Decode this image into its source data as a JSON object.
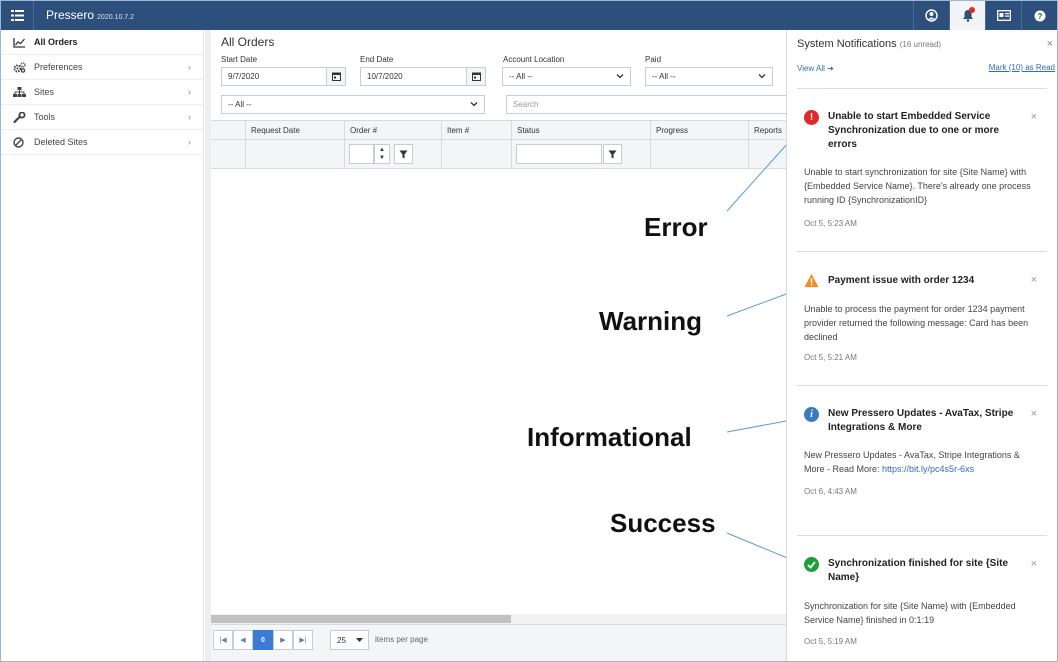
{
  "app": {
    "brand": "Pressero",
    "version": "2020.10.7.2"
  },
  "sidebar": {
    "items": [
      {
        "label": "All Orders",
        "icon": "chart-line-icon"
      },
      {
        "label": "Preferences",
        "icon": "cogs-icon"
      },
      {
        "label": "Sites",
        "icon": "sitemap-icon"
      },
      {
        "label": "Tools",
        "icon": "wrench-icon"
      },
      {
        "label": "Deleted Sites",
        "icon": "ban-icon"
      }
    ]
  },
  "main": {
    "title": "All Orders",
    "filters": {
      "start_date_label": "Start Date",
      "start_date_value": "9/7/2020",
      "end_date_label": "End Date",
      "end_date_value": "10/7/2020",
      "account_location_label": "Account Location",
      "account_location_value": "-- All --",
      "paid_label": "Paid",
      "paid_value": "-- All --",
      "second_row_select": "-- All --",
      "search_placeholder": "Search"
    },
    "columns": [
      "Request Date",
      "Order #",
      "Item #",
      "Status",
      "Progress",
      "Reports"
    ],
    "pager": {
      "current_page": "0",
      "page_size": "25",
      "page_size_label": "items per page"
    }
  },
  "notifications": {
    "title": "System Notifications",
    "unread": "(16 unread)",
    "view_all": "View All",
    "mark_read": "Mark (10) as Read",
    "items": [
      {
        "type": "error",
        "title": "Unable to start Embedded Service Synchronization due to one or more errors",
        "body": "Unable to start synchronization for site {Site Name} with {Embedded Service Name}. There's already one process running ID {SynchronizationID}",
        "time": "Oct 5, 5:23 AM"
      },
      {
        "type": "warning",
        "title": "Payment issue with order 1234",
        "body": "Unable to process the payment for order 1234 payment provider returned the following message: Card has been declined",
        "time": "Oct 5, 5:21 AM"
      },
      {
        "type": "info",
        "title": "New Pressero Updates - AvaTax, Stripe Integrations & More",
        "body": "New Pressero Updates - AvaTax, Stripe Integrations & More - Read More: ",
        "link": "https://bit.ly/pc4s5r-6xs",
        "time": "Oct 6, 4:43 AM"
      },
      {
        "type": "success",
        "title": "Synchronization finished for site {Site Name}",
        "body": "Synchronization for site {Site Name} with {Embedded Service Name} finished in 0:1:19",
        "time": "Oct 5, 5:19 AM"
      }
    ]
  },
  "annotations": {
    "error": "Error",
    "warning": "Warning",
    "informational": "Informational",
    "success": "Success"
  },
  "colors": {
    "topbar": "#2d4f7c",
    "error": "#e0292b",
    "warning": "#f28c1e",
    "info": "#3a7bbf",
    "success": "#1f9d3a",
    "arrow": "#5b9bd5"
  }
}
